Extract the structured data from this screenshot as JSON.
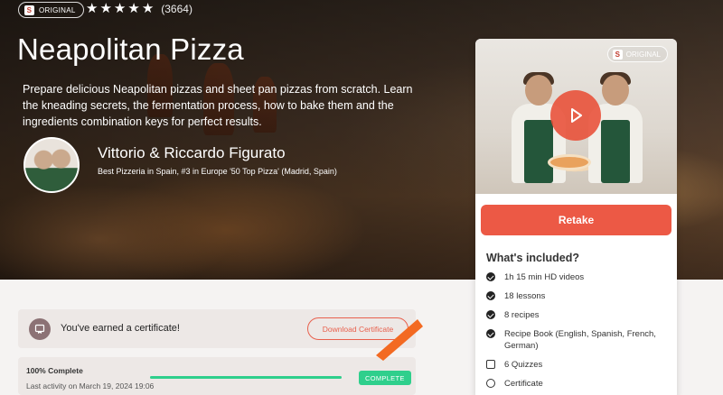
{
  "hero": {
    "badge_label": "ORIGINAL",
    "logo_glyph": "S",
    "rating": {
      "stars": 5,
      "count_text": "(3664)"
    },
    "title": "Neapolitan Pizza",
    "description": "Prepare delicious Neapolitan pizzas and sheet pan pizzas from scratch. Learn the kneading secrets, the fermentation process, how to bake them and the ingredients combination keys for perfect results.",
    "chef": {
      "name": "Vittorio & Riccardo Figurato",
      "bio": "Best Pizzeria in Spain, #3 in Europe '50 Top Pizza' (Madrid, Spain)"
    }
  },
  "card": {
    "badge_label": "ORIGINAL",
    "logo_glyph": "S",
    "retake_label": "Retake",
    "included_title": "What's included?",
    "items": [
      {
        "icon": "check-circle-icon",
        "label": "1h 15 min HD videos"
      },
      {
        "icon": "check-circle-icon",
        "label": "18 lessons"
      },
      {
        "icon": "check-circle-icon",
        "label": "8 recipes"
      },
      {
        "icon": "check-circle-icon",
        "label": "Recipe Book (English, Spanish, French, German)"
      },
      {
        "icon": "quiz-icon",
        "label": "6 Quizzes"
      },
      {
        "icon": "certificate-icon",
        "label": "Certificate"
      }
    ]
  },
  "certificate": {
    "text": "You've earned a certificate!",
    "download_label": "Download Certificate"
  },
  "progress": {
    "percent_text": "100% Complete",
    "percent": 100,
    "last_activity": "Last activity on March 19, 2024 19:06",
    "status_label": "COMPLETE"
  },
  "colors": {
    "accent": "#ec5945",
    "success": "#2fcf8c"
  }
}
